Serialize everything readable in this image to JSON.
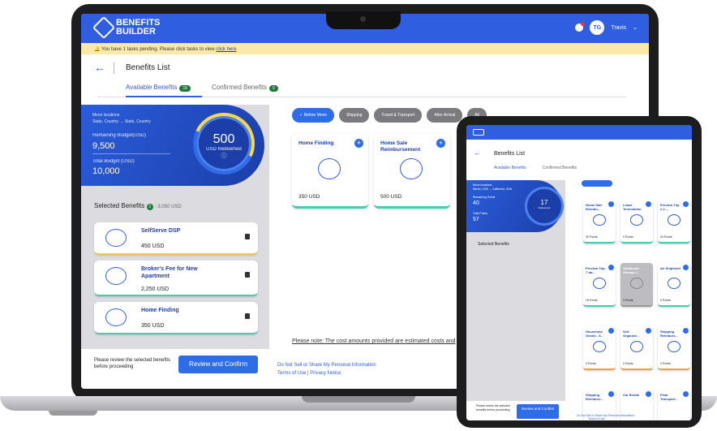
{
  "app": {
    "logo_line1": "BENEFITS",
    "logo_line2": "BUILDER",
    "user_initials": "TG",
    "user_name": "Travis"
  },
  "notice": {
    "text": "You have 1 tasks pending. Please click tasks to view",
    "link": "click here"
  },
  "page": {
    "title": "Benefits List"
  },
  "tabs": [
    {
      "label": "Available Benefits",
      "count": "16"
    },
    {
      "label": "Confirmed Benefits",
      "count": "0"
    }
  ],
  "summary": {
    "move_label": "Move locations",
    "move_value": "State, Country → State, Country",
    "remaining_label": "Remaining Budget(USD)",
    "remaining_value": "9,500",
    "total_label": "Total Budget (USD)",
    "total_value": "10,000",
    "redeemed_value": "500",
    "redeemed_label": "USD Redeemed"
  },
  "selected": {
    "title": "Selected Benefits",
    "count": "3",
    "total": "- 3,050 USD",
    "items": [
      {
        "name": "SelfServe DSP",
        "price": "450 USD"
      },
      {
        "name": "Broker's Fee for New Apartment",
        "price": "2,250 USD"
      },
      {
        "name": "Home Finding",
        "price": "350 USD"
      }
    ]
  },
  "footer": {
    "text": "Please review the selected benefits before proceeding",
    "button": "Review and Confirm"
  },
  "filters": [
    "Before Move",
    "Shipping",
    "Travel & Transport",
    "After Arrival",
    "All"
  ],
  "cards": [
    {
      "title": "Home Finding",
      "price": "350 USD"
    },
    {
      "title": "Home Sale Reimbursement",
      "price": "500 USD"
    }
  ],
  "note": "Please note: The cost amounts provided are estimated costs and",
  "links": {
    "privacy_sell": "Do Not Sell or Share My Personal Information",
    "terms": "Terms of Use",
    "privacy": "Privacy Notice"
  },
  "tablet": {
    "title": "Benefits List",
    "tab1": "Available Benefits",
    "tab2": "Confirmed Benefits",
    "move_label": "Move locations",
    "move_value": "Illinois, USA → California, USA",
    "remaining_label": "Remaining Points",
    "remaining_value": "40",
    "total_label": "Total Points",
    "total_value": "57",
    "ring_value": "17",
    "ring_label": "Redeemed",
    "selected_title": "Selected Benefits",
    "footer_text": "Please review the selected benefits before proceeding",
    "button": "Review and Confirm",
    "links_line1": "Do Not Sell or Share My Personal Information",
    "links_line2": "Terms of Use",
    "cards": [
      {
        "title": "Home Sale Reimbu...",
        "pts": "30 Points"
      },
      {
        "title": "Lease Termination",
        "pts": "0 Points"
      },
      {
        "title": "Preview Trip x 2-...",
        "pts": "26 Points"
      },
      {
        "title": "Preview Trip- 7 da...",
        "pts": "15 Points"
      },
      {
        "title": "Additional Storage I...",
        "pts": "0 Points"
      },
      {
        "title": "Air Shipment",
        "pts": "0 Points"
      },
      {
        "title": "Household Goods - 5...",
        "pts": "0 Points"
      },
      {
        "title": "Self Organize...",
        "pts": "0 Points"
      },
      {
        "title": "Shipping Reimburs...",
        "pts": "0 Points"
      },
      {
        "title": "Shipping Reimburs...",
        "pts": ""
      },
      {
        "title": "Car Rental",
        "pts": ""
      },
      {
        "title": "Final Transport...",
        "pts": ""
      }
    ]
  }
}
